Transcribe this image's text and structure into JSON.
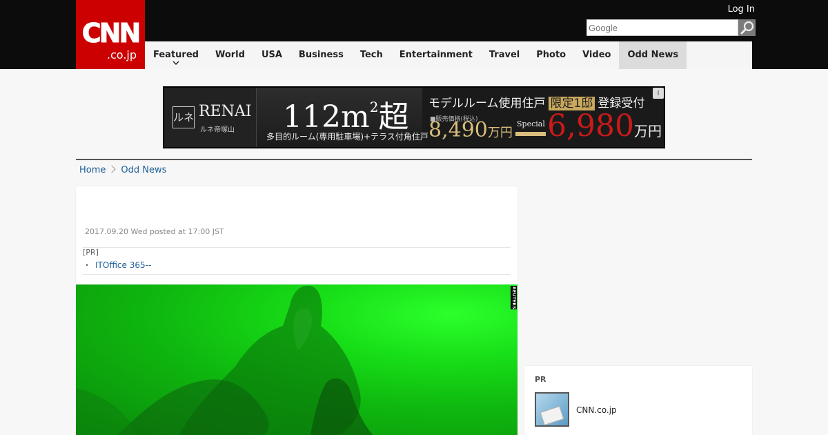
{
  "header": {
    "logo_main": "CNN",
    "logo_sub": ".co.jp",
    "login_label": "Log In",
    "search_placeholder": "Google"
  },
  "nav": {
    "items": [
      {
        "label": "Featured"
      },
      {
        "label": "World"
      },
      {
        "label": "USA"
      },
      {
        "label": "Business"
      },
      {
        "label": "Tech"
      },
      {
        "label": "Entertainment"
      },
      {
        "label": "Travel"
      },
      {
        "label": "Photo"
      },
      {
        "label": "Video"
      },
      {
        "label": "Odd News"
      }
    ],
    "active": "Odd News"
  },
  "ad": {
    "brand": "RENAI",
    "brand_mark": "ルネ",
    "brand_sub": "ルネ帝塚山",
    "size_text": "112m",
    "size_sup": "2",
    "size_suffix": "超",
    "rooms_text": "多目的ルーム(専用駐車場)+テラス付角住戸",
    "model_text": "モデルルーム使用住戸",
    "limited_text": "限定1邸",
    "register_text": "登録受付",
    "price_label": "■販売価格(税込)",
    "price_old": "8,490",
    "price_unit": "万円",
    "special_text": "Special",
    "price_new": "6,980",
    "info_icon": "i"
  },
  "breadcrumb": {
    "home": "Home",
    "current": "Odd News"
  },
  "article": {
    "dateline": "2017.09.20 Wed posted at 17:00 JST",
    "pr_label": "[PR]",
    "pr_bullet": "・",
    "pr_link": "ITOffice 365--",
    "photo_credit": "REUTERS"
  },
  "side_pr": {
    "label": "PR",
    "item_text": "CNN.co.jp"
  },
  "colors": {
    "brand_red": "#cc0000",
    "header_bg": "#0c0c0c",
    "link_blue": "#1b5e96",
    "photo_green": "#18e018"
  }
}
